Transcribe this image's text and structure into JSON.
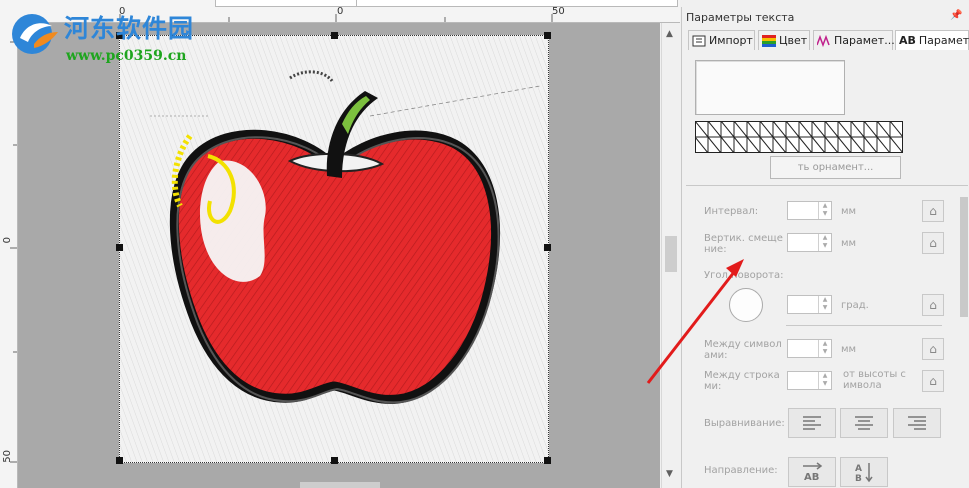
{
  "logo": {
    "title": "河东软件园",
    "url": "www.pc0359.cn"
  },
  "ruler": {
    "top_labels": [
      "0",
      "0",
      "50"
    ],
    "left_labels": [
      "0",
      "50"
    ]
  },
  "panel": {
    "title": "Параметры текста",
    "pin_icon": "pin-icon",
    "tabs": [
      {
        "label": "Импорт",
        "icon": "import-icon",
        "active": false
      },
      {
        "label": "Цвет",
        "icon": "color-icon",
        "active": false
      },
      {
        "label": "Парамет...",
        "icon": "stitch-params-icon",
        "active": false
      },
      {
        "label": "Парамет...",
        "icon": "text-ab-icon",
        "active": true
      }
    ],
    "ornament_button": "ть орнамент...",
    "fields": {
      "interval": {
        "label": "Интервал:",
        "unit": "мм",
        "value": ""
      },
      "vertical_shift": {
        "label": "Вертик. смеще\nние:",
        "unit": "мм",
        "value": ""
      },
      "rotation_angle": {
        "label": "Угол поворота:",
        "unit": "град.",
        "value": ""
      },
      "char_spacing": {
        "label": "Между символ\nами:",
        "unit": "мм",
        "value": ""
      },
      "line_spacing": {
        "label": "Между строка\nми:",
        "unit": "от высоты с\nимвола",
        "value": ""
      }
    },
    "alignment": {
      "label": "Выравнивание:",
      "options": [
        "align-left-icon",
        "align-center-icon",
        "align-right-icon"
      ]
    },
    "direction": {
      "label": "Направление:",
      "options": [
        "direction-horizontal-icon",
        "direction-vertical-icon"
      ]
    }
  },
  "colors": {
    "accent_arrow": "#e21b1b",
    "apple_red": "#e8282a",
    "workspace_bg": "#a9a9a9"
  }
}
